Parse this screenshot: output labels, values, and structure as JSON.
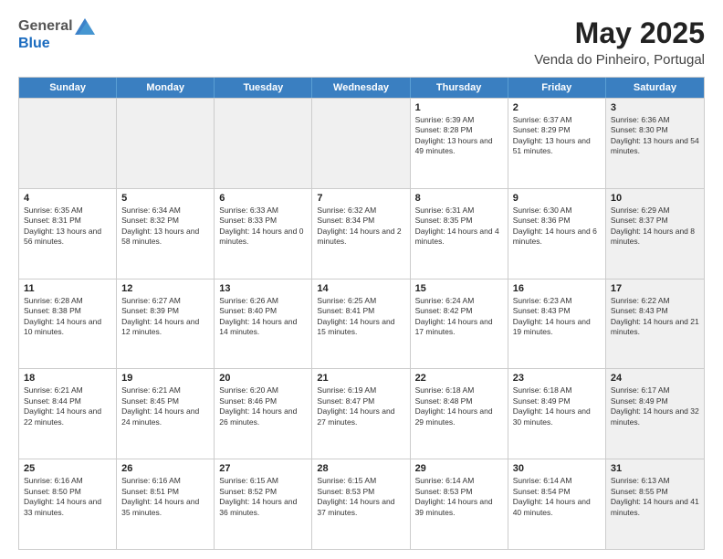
{
  "header": {
    "logo_general": "General",
    "logo_blue": "Blue",
    "month_title": "May 2025",
    "location": "Venda do Pinheiro, Portugal"
  },
  "days_of_week": [
    "Sunday",
    "Monday",
    "Tuesday",
    "Wednesday",
    "Thursday",
    "Friday",
    "Saturday"
  ],
  "rows": [
    [
      {
        "day": "",
        "sunrise": "",
        "sunset": "",
        "daylight": "",
        "shaded": true
      },
      {
        "day": "",
        "sunrise": "",
        "sunset": "",
        "daylight": "",
        "shaded": true
      },
      {
        "day": "",
        "sunrise": "",
        "sunset": "",
        "daylight": "",
        "shaded": true
      },
      {
        "day": "",
        "sunrise": "",
        "sunset": "",
        "daylight": "",
        "shaded": true
      },
      {
        "day": "1",
        "sunrise": "Sunrise: 6:39 AM",
        "sunset": "Sunset: 8:28 PM",
        "daylight": "Daylight: 13 hours and 49 minutes."
      },
      {
        "day": "2",
        "sunrise": "Sunrise: 6:37 AM",
        "sunset": "Sunset: 8:29 PM",
        "daylight": "Daylight: 13 hours and 51 minutes."
      },
      {
        "day": "3",
        "sunrise": "Sunrise: 6:36 AM",
        "sunset": "Sunset: 8:30 PM",
        "daylight": "Daylight: 13 hours and 54 minutes.",
        "shaded": true
      }
    ],
    [
      {
        "day": "4",
        "sunrise": "Sunrise: 6:35 AM",
        "sunset": "Sunset: 8:31 PM",
        "daylight": "Daylight: 13 hours and 56 minutes."
      },
      {
        "day": "5",
        "sunrise": "Sunrise: 6:34 AM",
        "sunset": "Sunset: 8:32 PM",
        "daylight": "Daylight: 13 hours and 58 minutes."
      },
      {
        "day": "6",
        "sunrise": "Sunrise: 6:33 AM",
        "sunset": "Sunset: 8:33 PM",
        "daylight": "Daylight: 14 hours and 0 minutes."
      },
      {
        "day": "7",
        "sunrise": "Sunrise: 6:32 AM",
        "sunset": "Sunset: 8:34 PM",
        "daylight": "Daylight: 14 hours and 2 minutes."
      },
      {
        "day": "8",
        "sunrise": "Sunrise: 6:31 AM",
        "sunset": "Sunset: 8:35 PM",
        "daylight": "Daylight: 14 hours and 4 minutes."
      },
      {
        "day": "9",
        "sunrise": "Sunrise: 6:30 AM",
        "sunset": "Sunset: 8:36 PM",
        "daylight": "Daylight: 14 hours and 6 minutes."
      },
      {
        "day": "10",
        "sunrise": "Sunrise: 6:29 AM",
        "sunset": "Sunset: 8:37 PM",
        "daylight": "Daylight: 14 hours and 8 minutes.",
        "shaded": true
      }
    ],
    [
      {
        "day": "11",
        "sunrise": "Sunrise: 6:28 AM",
        "sunset": "Sunset: 8:38 PM",
        "daylight": "Daylight: 14 hours and 10 minutes."
      },
      {
        "day": "12",
        "sunrise": "Sunrise: 6:27 AM",
        "sunset": "Sunset: 8:39 PM",
        "daylight": "Daylight: 14 hours and 12 minutes."
      },
      {
        "day": "13",
        "sunrise": "Sunrise: 6:26 AM",
        "sunset": "Sunset: 8:40 PM",
        "daylight": "Daylight: 14 hours and 14 minutes."
      },
      {
        "day": "14",
        "sunrise": "Sunrise: 6:25 AM",
        "sunset": "Sunset: 8:41 PM",
        "daylight": "Daylight: 14 hours and 15 minutes."
      },
      {
        "day": "15",
        "sunrise": "Sunrise: 6:24 AM",
        "sunset": "Sunset: 8:42 PM",
        "daylight": "Daylight: 14 hours and 17 minutes."
      },
      {
        "day": "16",
        "sunrise": "Sunrise: 6:23 AM",
        "sunset": "Sunset: 8:43 PM",
        "daylight": "Daylight: 14 hours and 19 minutes."
      },
      {
        "day": "17",
        "sunrise": "Sunrise: 6:22 AM",
        "sunset": "Sunset: 8:43 PM",
        "daylight": "Daylight: 14 hours and 21 minutes.",
        "shaded": true
      }
    ],
    [
      {
        "day": "18",
        "sunrise": "Sunrise: 6:21 AM",
        "sunset": "Sunset: 8:44 PM",
        "daylight": "Daylight: 14 hours and 22 minutes."
      },
      {
        "day": "19",
        "sunrise": "Sunrise: 6:21 AM",
        "sunset": "Sunset: 8:45 PM",
        "daylight": "Daylight: 14 hours and 24 minutes."
      },
      {
        "day": "20",
        "sunrise": "Sunrise: 6:20 AM",
        "sunset": "Sunset: 8:46 PM",
        "daylight": "Daylight: 14 hours and 26 minutes."
      },
      {
        "day": "21",
        "sunrise": "Sunrise: 6:19 AM",
        "sunset": "Sunset: 8:47 PM",
        "daylight": "Daylight: 14 hours and 27 minutes."
      },
      {
        "day": "22",
        "sunrise": "Sunrise: 6:18 AM",
        "sunset": "Sunset: 8:48 PM",
        "daylight": "Daylight: 14 hours and 29 minutes."
      },
      {
        "day": "23",
        "sunrise": "Sunrise: 6:18 AM",
        "sunset": "Sunset: 8:49 PM",
        "daylight": "Daylight: 14 hours and 30 minutes."
      },
      {
        "day": "24",
        "sunrise": "Sunrise: 6:17 AM",
        "sunset": "Sunset: 8:49 PM",
        "daylight": "Daylight: 14 hours and 32 minutes.",
        "shaded": true
      }
    ],
    [
      {
        "day": "25",
        "sunrise": "Sunrise: 6:16 AM",
        "sunset": "Sunset: 8:50 PM",
        "daylight": "Daylight: 14 hours and 33 minutes."
      },
      {
        "day": "26",
        "sunrise": "Sunrise: 6:16 AM",
        "sunset": "Sunset: 8:51 PM",
        "daylight": "Daylight: 14 hours and 35 minutes."
      },
      {
        "day": "27",
        "sunrise": "Sunrise: 6:15 AM",
        "sunset": "Sunset: 8:52 PM",
        "daylight": "Daylight: 14 hours and 36 minutes."
      },
      {
        "day": "28",
        "sunrise": "Sunrise: 6:15 AM",
        "sunset": "Sunset: 8:53 PM",
        "daylight": "Daylight: 14 hours and 37 minutes."
      },
      {
        "day": "29",
        "sunrise": "Sunrise: 6:14 AM",
        "sunset": "Sunset: 8:53 PM",
        "daylight": "Daylight: 14 hours and 39 minutes."
      },
      {
        "day": "30",
        "sunrise": "Sunrise: 6:14 AM",
        "sunset": "Sunset: 8:54 PM",
        "daylight": "Daylight: 14 hours and 40 minutes."
      },
      {
        "day": "31",
        "sunrise": "Sunrise: 6:13 AM",
        "sunset": "Sunset: 8:55 PM",
        "daylight": "Daylight: 14 hours and 41 minutes.",
        "shaded": true
      }
    ]
  ]
}
